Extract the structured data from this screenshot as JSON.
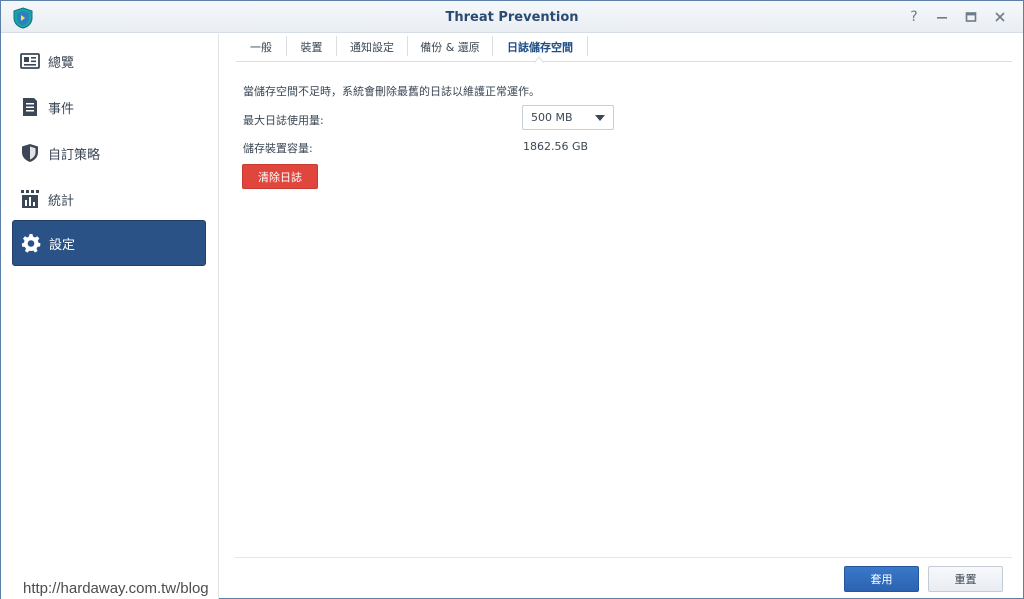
{
  "window": {
    "title": "Threat Prevention",
    "controls": {
      "help_glyph": "?",
      "minimize_glyph": "—",
      "maximize_glyph": "▭",
      "close_glyph": "✕"
    }
  },
  "sidebar": {
    "items": [
      {
        "label": "總覽",
        "icon": "overview-card-icon",
        "active": false
      },
      {
        "label": "事件",
        "icon": "events-document-icon",
        "active": false
      },
      {
        "label": "自訂策略",
        "icon": "shield-icon",
        "active": false
      },
      {
        "label": "統計",
        "icon": "statistics-chart-icon",
        "active": false
      },
      {
        "label": "設定",
        "icon": "gear-icon",
        "active": true
      }
    ]
  },
  "tabs": [
    {
      "label": "一般",
      "active": false
    },
    {
      "label": "裝置",
      "active": false
    },
    {
      "label": "通知設定",
      "active": false
    },
    {
      "label": "備份 & 還原",
      "active": false
    },
    {
      "label": "日誌儲存空間",
      "active": true
    }
  ],
  "log_storage": {
    "description": "當儲存空間不足時，系統會刪除最舊的日誌以維護正常運作。",
    "max_usage_label": "最大日誌使用量:",
    "max_usage_value": "500 MB",
    "device_capacity_label": "儲存裝置容量:",
    "device_capacity_value": "1862.56 GB",
    "clear_button": "清除日誌"
  },
  "footer": {
    "apply_button": "套用",
    "reset_button": "重置"
  },
  "watermark": "http://hardaway.com.tw/blog",
  "colors": {
    "accent": "#2b5287",
    "danger": "#e0463c",
    "primary_button": "#2c63b0"
  }
}
